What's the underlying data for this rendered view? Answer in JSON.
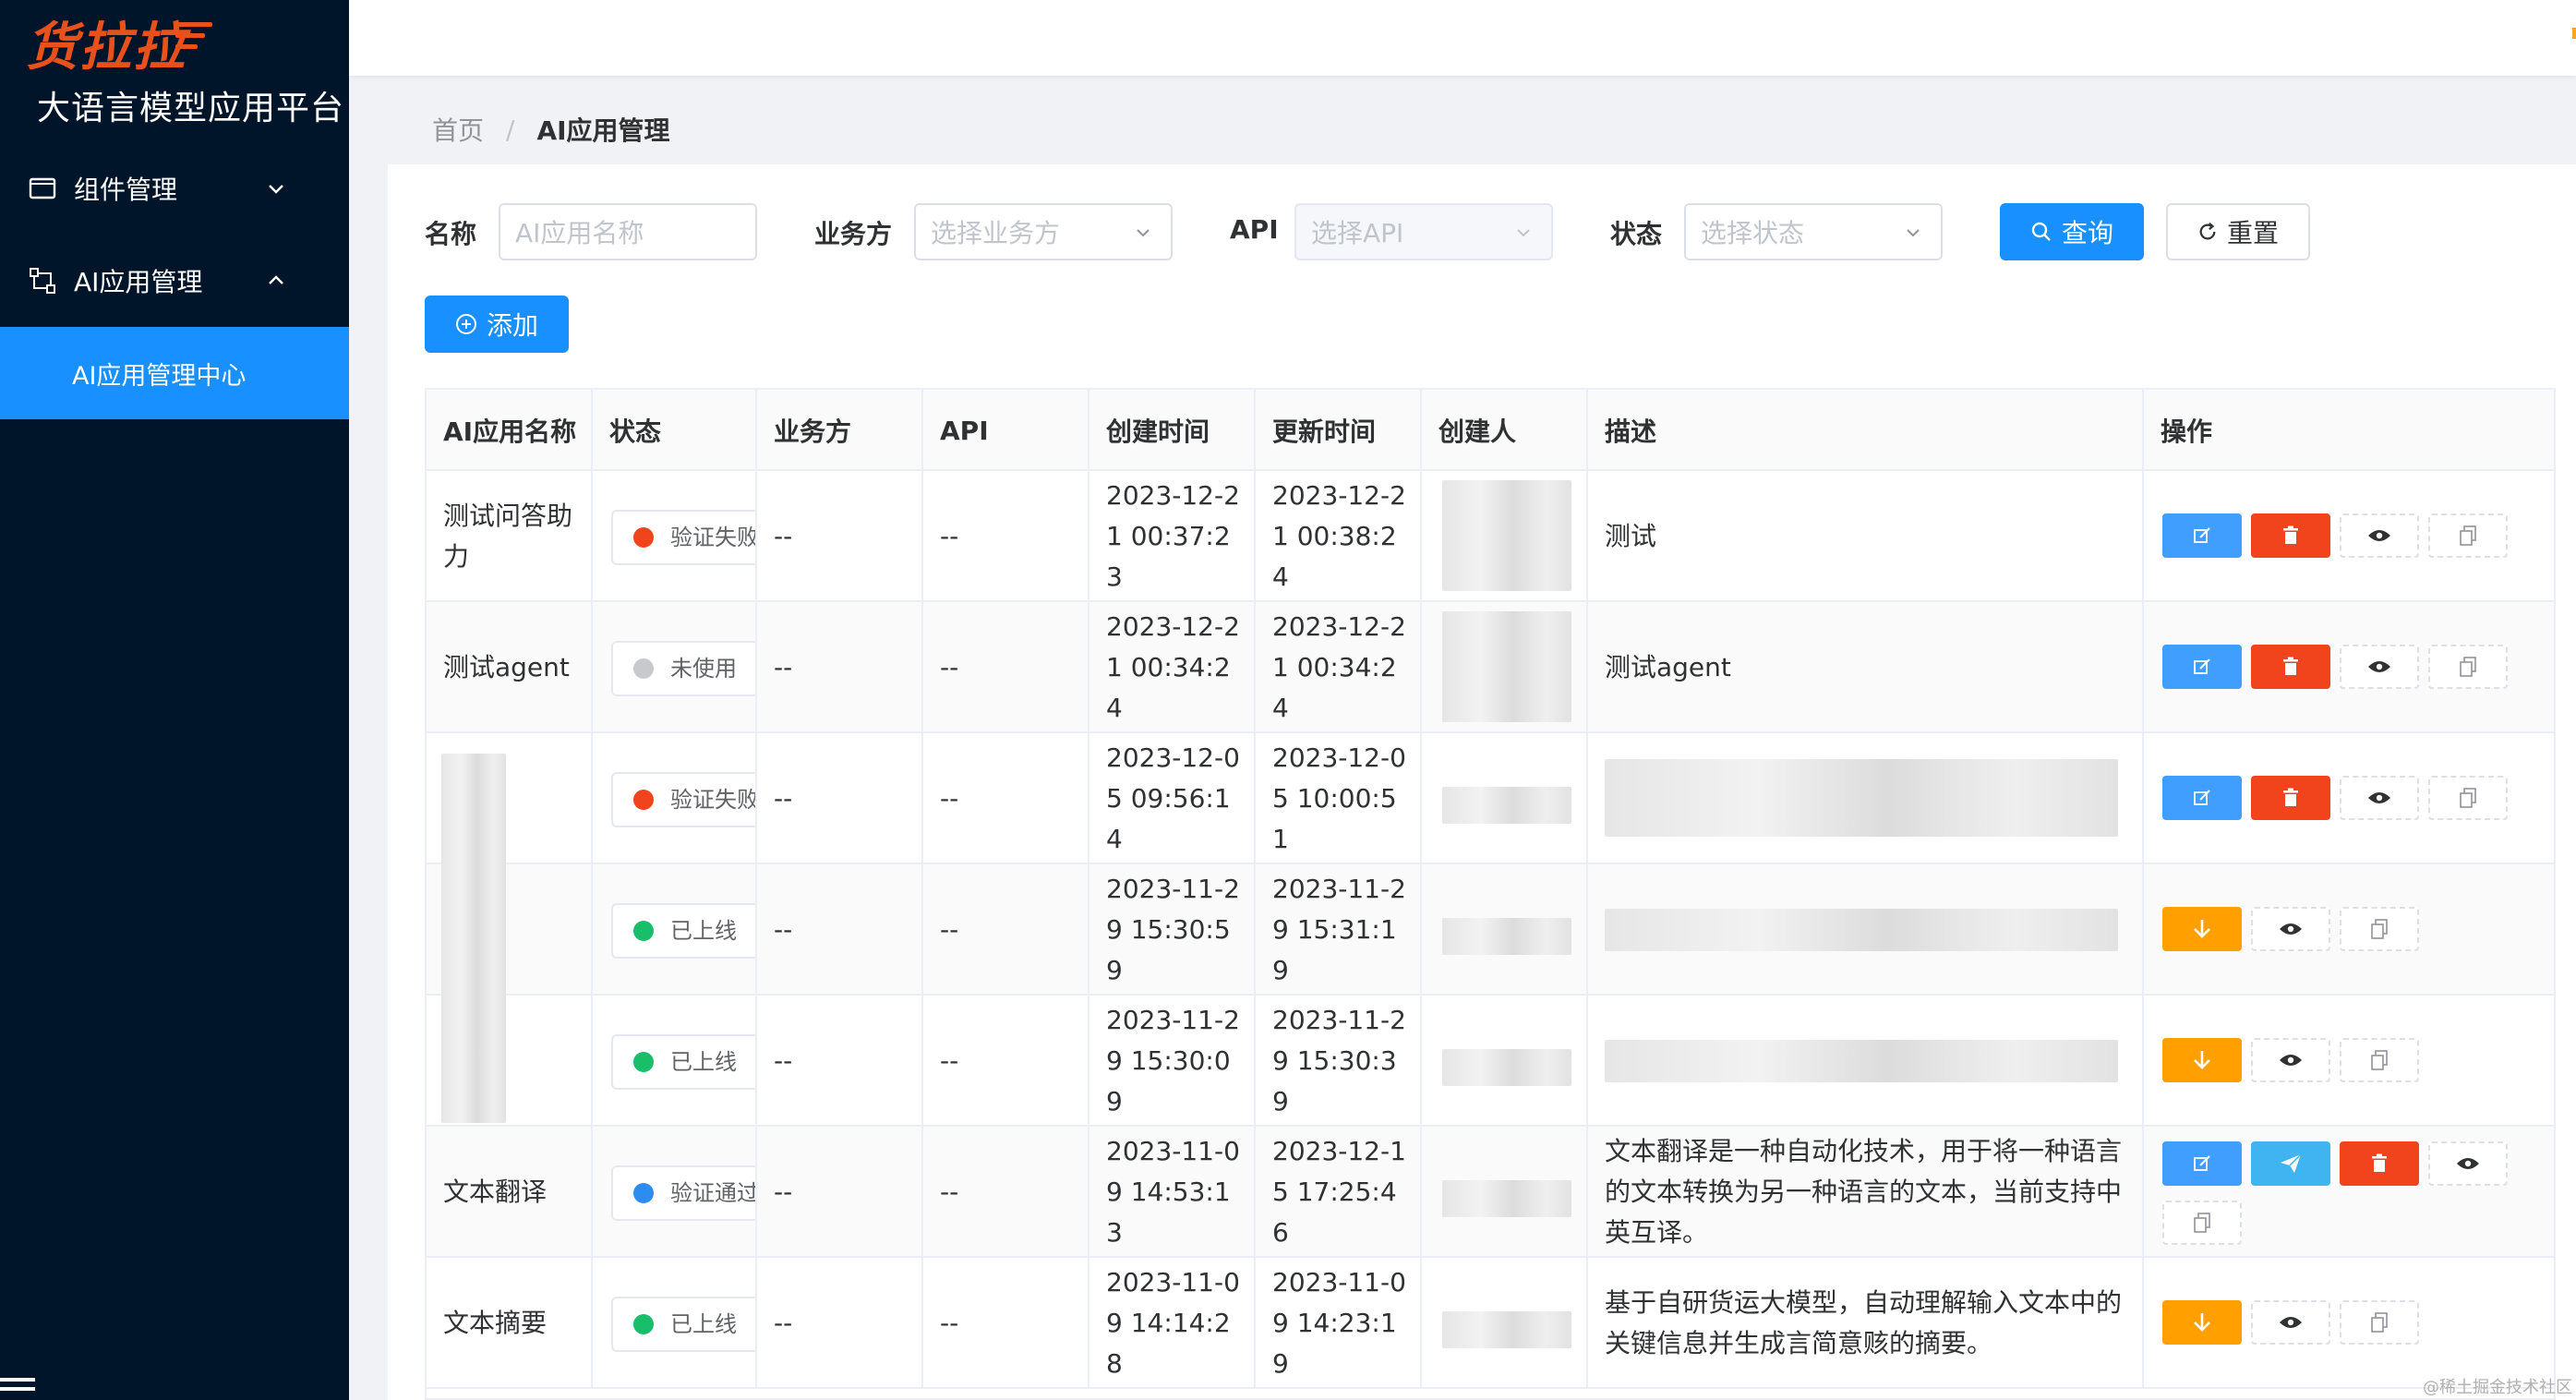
{
  "sidebar": {
    "logo": "货拉拉",
    "platform_title": "大语言模型应用平台",
    "menu": [
      {
        "label": "组件管理",
        "icon": "window-icon",
        "expanded": false
      },
      {
        "label": "AI应用管理",
        "icon": "flow-icon",
        "expanded": true
      }
    ],
    "submenu_active": "AI应用管理中心"
  },
  "breadcrumb": {
    "home": "首页",
    "separator": "/",
    "current": "AI应用管理"
  },
  "filters": {
    "name_label": "名称",
    "name_placeholder": "AI应用名称",
    "biz_label": "业务方",
    "biz_placeholder": "选择业务方",
    "api_label": "API",
    "api_placeholder": "选择API",
    "status_label": "状态",
    "status_placeholder": "选择状态",
    "query_label": "查询",
    "reset_label": "重置"
  },
  "add_label": "添加",
  "table": {
    "headers": [
      "AI应用名称",
      "状态",
      "业务方",
      "API",
      "创建时间",
      "更新时间",
      "创建人",
      "描述",
      "操作"
    ],
    "rows": [
      {
        "name": "测试问答助力",
        "status": "验证失败",
        "status_color": "#f1441d",
        "biz": "--",
        "api": "--",
        "created": "2023-12-21 00:37:23",
        "updated": "2023-12-21 00:38:24",
        "desc": "测试",
        "actions": [
          "edit",
          "delete",
          "view",
          "copy"
        ]
      },
      {
        "name": "测试agent",
        "status": "未使用",
        "status_color": "#c8c9cc",
        "biz": "--",
        "api": "--",
        "created": "2023-12-21 00:34:24",
        "updated": "2023-12-21 00:34:24",
        "desc": "测试agent",
        "actions": [
          "edit",
          "delete",
          "view",
          "copy"
        ]
      },
      {
        "name": "",
        "status": "验证失败",
        "status_color": "#f1441d",
        "biz": "--",
        "api": "--",
        "created": "2023-12-05 09:56:14",
        "updated": "2023-12-05 10:00:51",
        "desc": "",
        "actions": [
          "edit",
          "delete",
          "view",
          "copy"
        ]
      },
      {
        "name": "",
        "status": "已上线",
        "status_color": "#19be6b",
        "biz": "--",
        "api": "--",
        "created": "2023-11-29 15:30:59",
        "updated": "2023-11-29 15:31:19",
        "desc": "",
        "actions": [
          "offline",
          "view",
          "copy"
        ]
      },
      {
        "name": "",
        "status": "已上线",
        "status_color": "#19be6b",
        "biz": "--",
        "api": "--",
        "created": "2023-11-29 15:30:09",
        "updated": "2023-11-29 15:30:39",
        "desc": "",
        "actions": [
          "offline",
          "view",
          "copy"
        ]
      },
      {
        "name": "文本翻译",
        "status": "验证通过",
        "status_color": "#2d8cf0",
        "biz": "--",
        "api": "--",
        "created": "2023-11-09 14:53:13",
        "updated": "2023-12-15 17:25:46",
        "desc": "文本翻译是一种自动化技术，用于将一种语言的文本转换为另一种语言的文本，当前支持中英互译。",
        "actions": [
          "edit",
          "publish",
          "delete",
          "view",
          "copy"
        ]
      },
      {
        "name": "文本摘要",
        "status": "已上线",
        "status_color": "#19be6b",
        "biz": "--",
        "api": "--",
        "created": "2023-11-09 14:14:28",
        "updated": "2023-11-09 14:23:19",
        "desc": "基于自研货运大模型，自动理解输入文本中的关键信息并生成言简意赅的摘要。",
        "actions": [
          "offline",
          "view",
          "copy"
        ]
      }
    ]
  },
  "watermark": "@稀土掘金技术社区"
}
